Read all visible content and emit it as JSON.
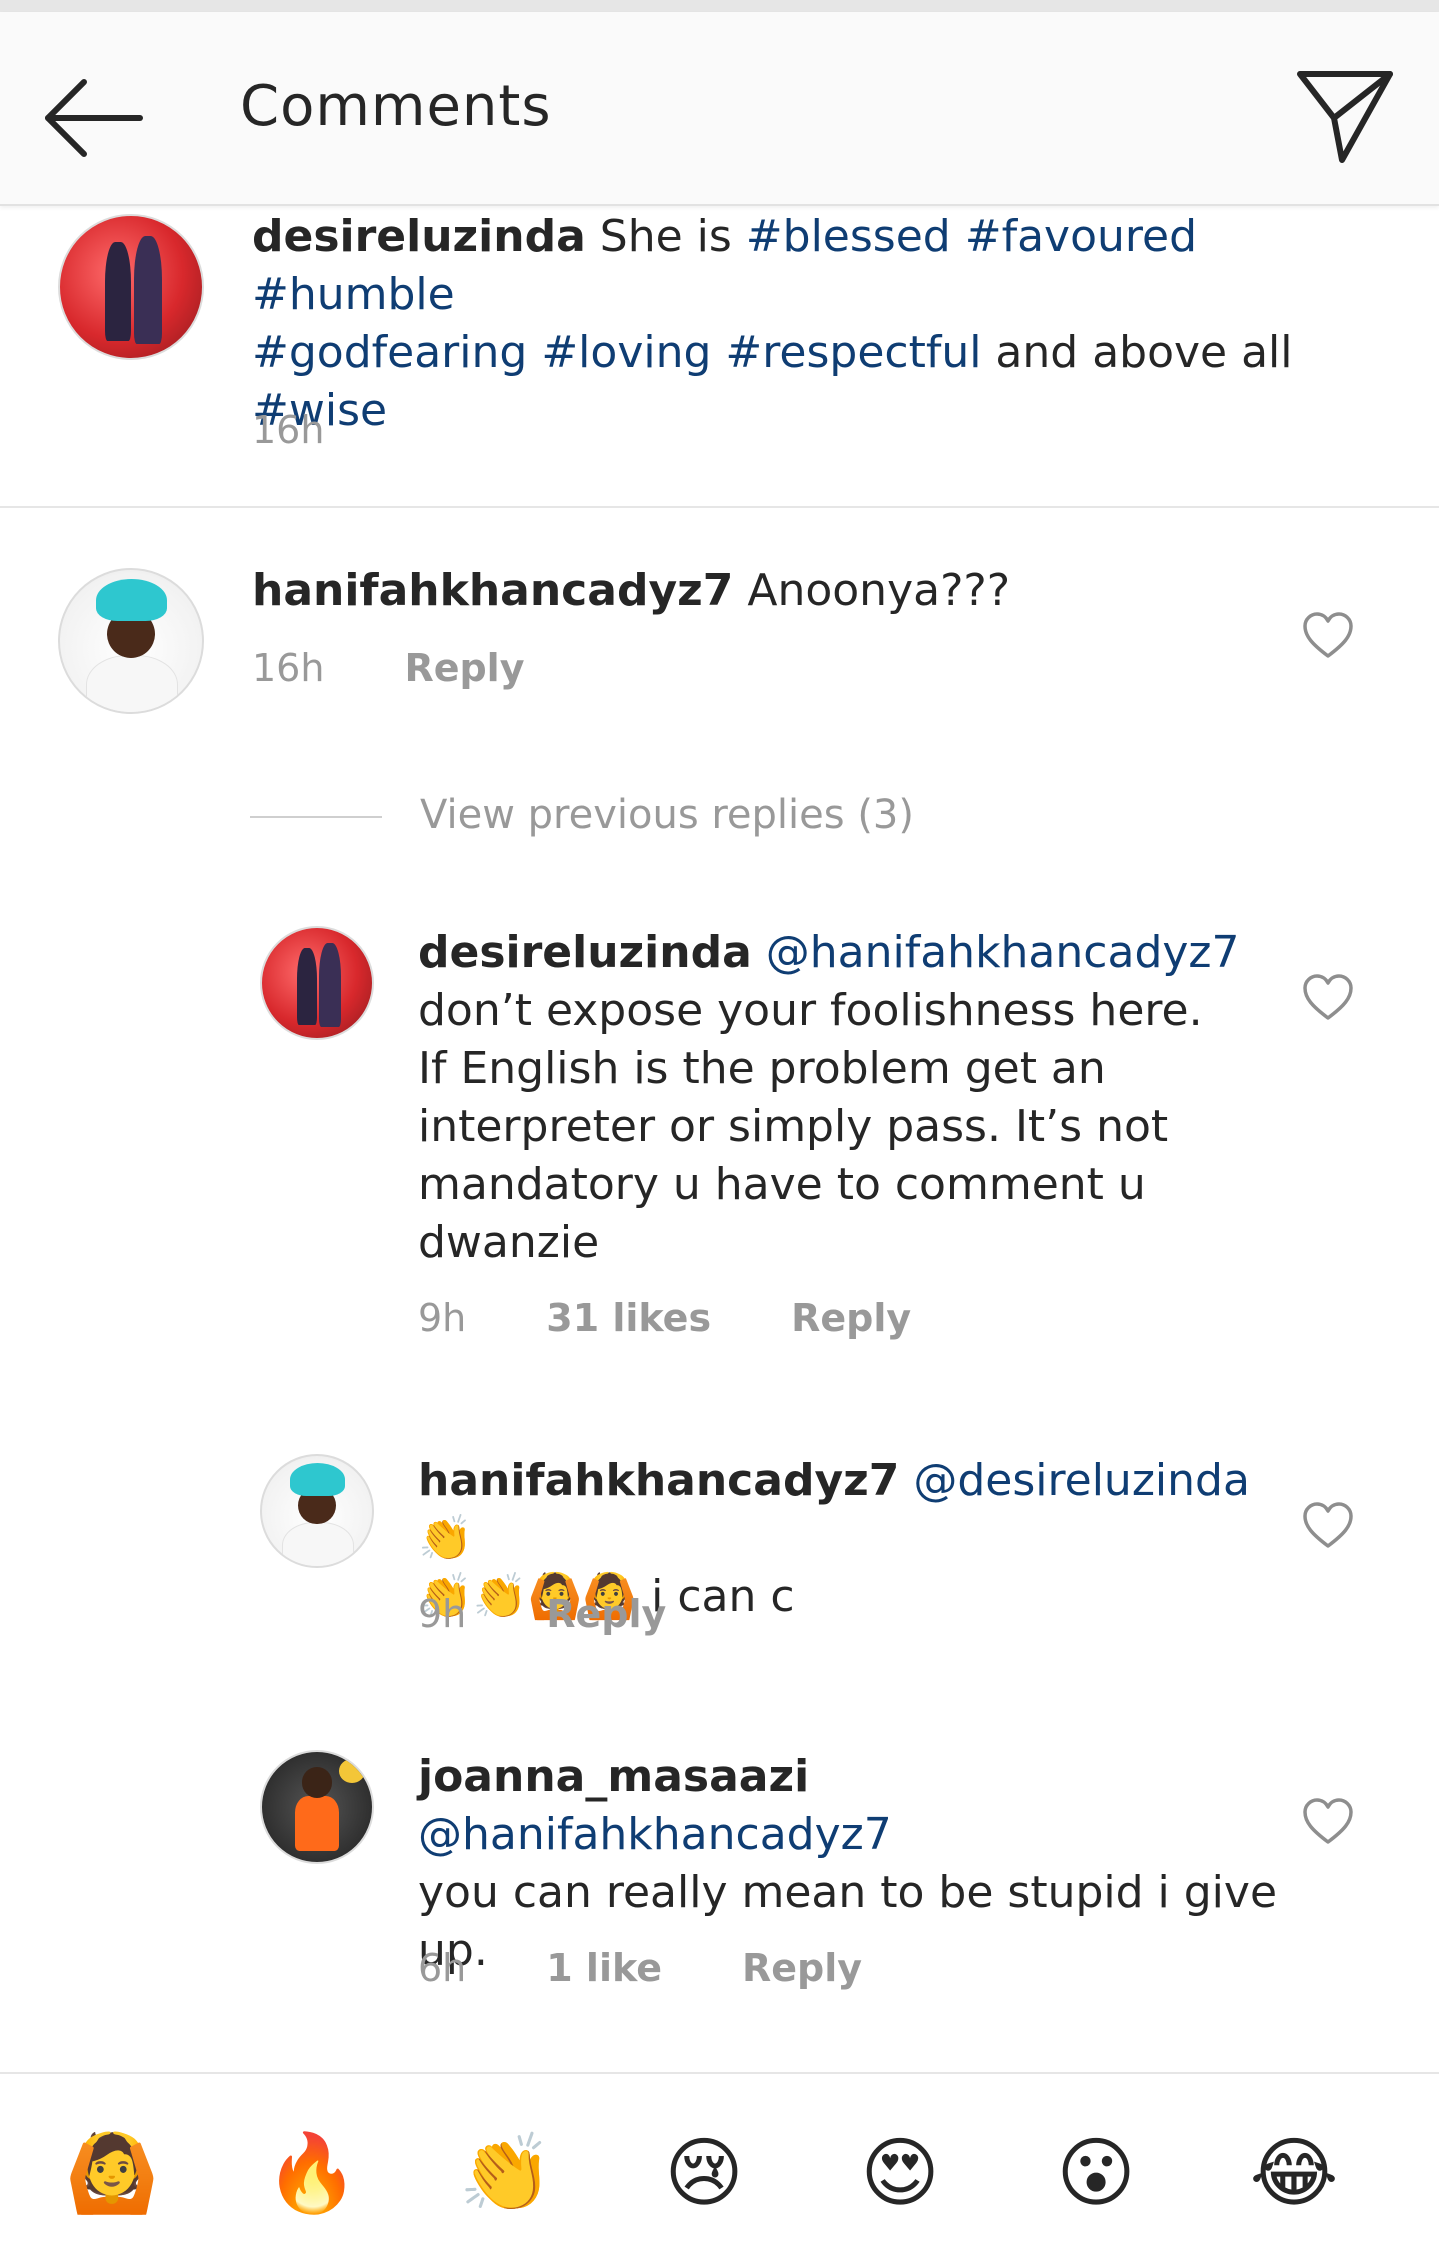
{
  "header": {
    "title": "Comments",
    "back_icon": "arrow-left-icon",
    "send_icon": "paper-plane-icon"
  },
  "caption": {
    "username": "desireluzinda",
    "text_lines": [
      [
        {
          "t": "She is ",
          "tag": false
        },
        {
          "t": "#blessed",
          "tag": true
        },
        {
          "t": " ",
          "tag": false
        },
        {
          "t": "#favoured",
          "tag": true
        },
        {
          "t": " ",
          "tag": false
        },
        {
          "t": "#humble",
          "tag": true
        }
      ],
      [
        {
          "t": "#godfearing",
          "tag": true
        },
        {
          "t": " ",
          "tag": false
        },
        {
          "t": "#loving",
          "tag": true
        },
        {
          "t": " ",
          "tag": false
        },
        {
          "t": "#respectful",
          "tag": true
        },
        {
          "t": " and above all",
          "tag": false
        }
      ],
      [
        {
          "t": "#wise",
          "tag": true
        }
      ]
    ],
    "time": "16h"
  },
  "comments": [
    {
      "username": "hanifahkhancadyz7",
      "text": "Anoonya???",
      "time": "16h",
      "reply": "Reply"
    }
  ],
  "view_previous": "View previous replies (3)",
  "replies": [
    {
      "username": "desireluzinda",
      "mention": "@hanifahkhancadyz7",
      "lines": [
        "don’t expose your foolishness here.",
        "If English is the problem get an",
        "interpreter or simply pass. It’s not",
        "mandatory u have to comment u",
        "dwanzie"
      ],
      "time": "9h",
      "likes": "31 likes",
      "reply": "Reply"
    },
    {
      "username": "hanifahkhancadyz7",
      "mention": "@desireluzinda",
      "line1_emoji": "👏",
      "line2": "👏👏🙆🙆 i can c",
      "time": "9h",
      "reply": "Reply"
    },
    {
      "username": "joanna_masaazi",
      "mention": "@hanifahkhancadyz7",
      "lines": [
        "you can really mean to be stupid i give",
        "up."
      ],
      "time": "6h",
      "likes": "1 like",
      "reply": "Reply"
    }
  ],
  "emoji_bar": [
    "🙆",
    "🔥",
    "👏",
    "😢",
    "😍",
    "😮",
    "😂"
  ],
  "colors": {
    "hashtag": "#0f3d73",
    "meta": "#999999",
    "text": "#262626"
  }
}
